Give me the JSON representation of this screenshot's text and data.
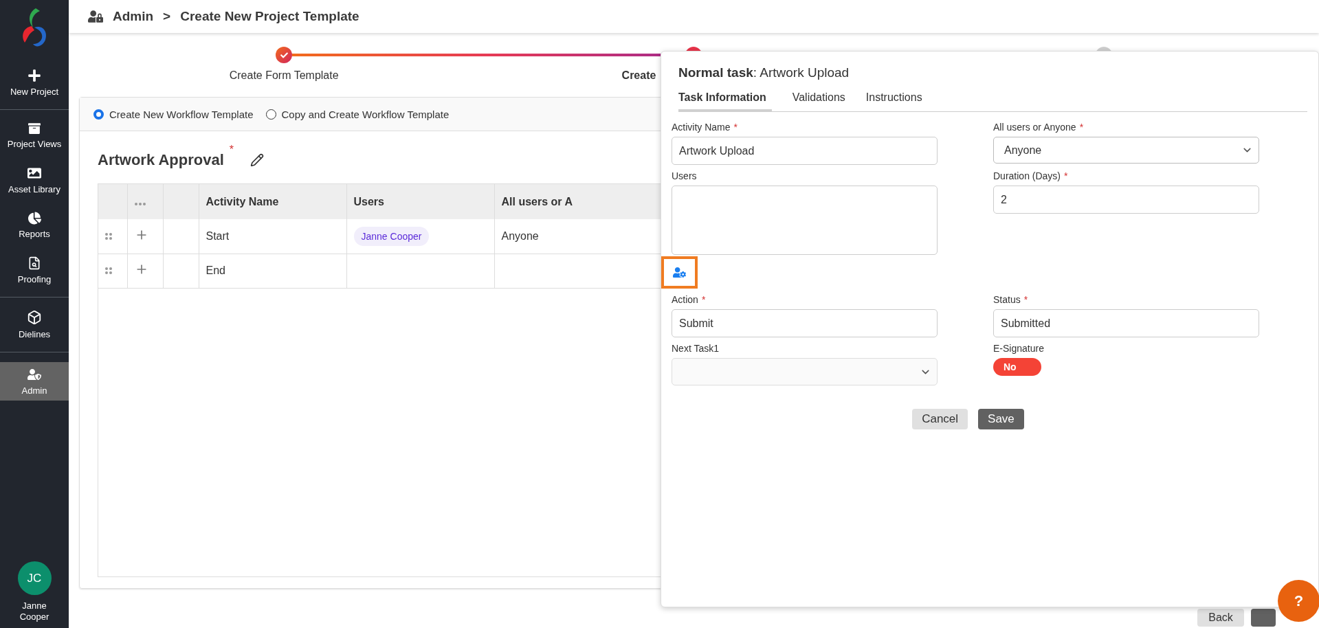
{
  "sidebar": {
    "groups": [
      [
        {
          "label": "New Project",
          "selected": false
        }
      ],
      [
        {
          "label": "Project Views",
          "selected": false
        },
        {
          "label": "Asset Library",
          "selected": false
        },
        {
          "label": "Reports",
          "selected": false
        },
        {
          "label": "Proofing",
          "selected": false
        }
      ],
      [
        {
          "label": "Dielines",
          "selected": false
        }
      ],
      [
        {
          "label": "Admin",
          "selected": true
        }
      ]
    ],
    "user": {
      "initials": "JC",
      "name": "Janne Cooper"
    }
  },
  "top_bar": {
    "breadcrumb": [
      "Admin",
      "Create New Project Template"
    ],
    "separator": ">"
  },
  "stepper": [
    {
      "label": "Create Form Template",
      "completed": true,
      "active": false
    },
    {
      "label": "Create",
      "completed": false,
      "active": true
    },
    {
      "completed": false,
      "active": false
    }
  ],
  "workflow_options": [
    {
      "label": "Create New Workflow Template",
      "selected": true
    },
    {
      "label": "Copy and Create Workflow Template",
      "selected": false
    }
  ],
  "template": {
    "title": "Artwork Approval",
    "required_mark": "*"
  },
  "table": {
    "columns": [
      "Activity Name",
      "Users",
      "All users or A"
    ],
    "rows": [
      {
        "activity": "Start",
        "users": [
          "Janne Cooper"
        ],
        "mode": "Anyone"
      },
      {
        "activity": "End"
      }
    ]
  },
  "page_buttons": [
    {
      "kind": "secondary",
      "label": "Back"
    },
    {
      "kind": "primary"
    }
  ],
  "task_panel": {
    "title": "**Normal task**: Artwork Upload",
    "tabs": [
      {
        "label": "Task Information",
        "selected": true
      },
      {
        "label": "Validations",
        "selected": false
      },
      {
        "label": "Instructions",
        "selected": false
      }
    ],
    "fields": [
      {
        "kind": "text",
        "label": "Activity Name",
        "required_mark": "*",
        "value": "Artwork Upload"
      },
      {
        "kind": "select",
        "label": "All users or Anyone",
        "required_mark": "*",
        "value": "Anyone",
        "bordered": true
      },
      {
        "kind": "textarea",
        "label": "Users"
      },
      {
        "kind": "text",
        "label": "Duration (Days)",
        "required_mark": "*",
        "value": "2"
      },
      {
        "kind": "text",
        "label": "Action",
        "required_mark": "*",
        "value": "Submit"
      },
      {
        "kind": "text",
        "label": "Status",
        "required_mark": "*",
        "value": "Submitted"
      },
      {
        "kind": "select",
        "label": "Next Task1",
        "bordered": false
      },
      {
        "kind": "toggle",
        "label": "E-Signature",
        "on": false,
        "text": "No"
      }
    ],
    "buttons": [
      {
        "kind": "secondary",
        "label": "Cancel"
      },
      {
        "kind": "primary",
        "label": "Save"
      }
    ]
  },
  "help_button": {
    "label": "?"
  }
}
